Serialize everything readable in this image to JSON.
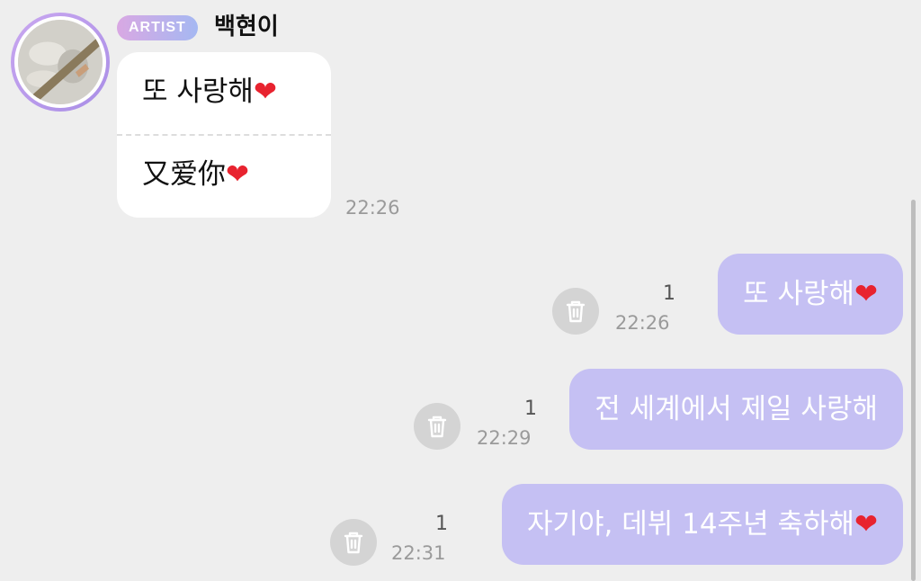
{
  "sender": {
    "badge": "ARTIST",
    "name": "백현이"
  },
  "received": {
    "line1": "또 사랑해",
    "line2": "又爱你",
    "heart": "❤",
    "time": "22:26"
  },
  "sent": [
    {
      "text": "또 사랑해",
      "heart": "❤",
      "count": "1",
      "time": "22:26"
    },
    {
      "text": "전 세계에서 제일 사랑해",
      "heart": "",
      "count": "1",
      "time": "22:29"
    },
    {
      "text": "자기야, 데뷔 14주년 축하해",
      "heart": "❤",
      "count": "1",
      "time": "22:31"
    }
  ],
  "icons": {
    "avatar": "profile-photo",
    "delete": "trash-icon",
    "heart": "red-heart"
  },
  "colors": {
    "background": "#eeeeee",
    "sent_bubble": "#c5c0f3",
    "received_bubble": "#ffffff",
    "heart": "#e8232f",
    "badge_gradient_start": "#d9a8e3",
    "badge_gradient_end": "#a5b8f2"
  }
}
